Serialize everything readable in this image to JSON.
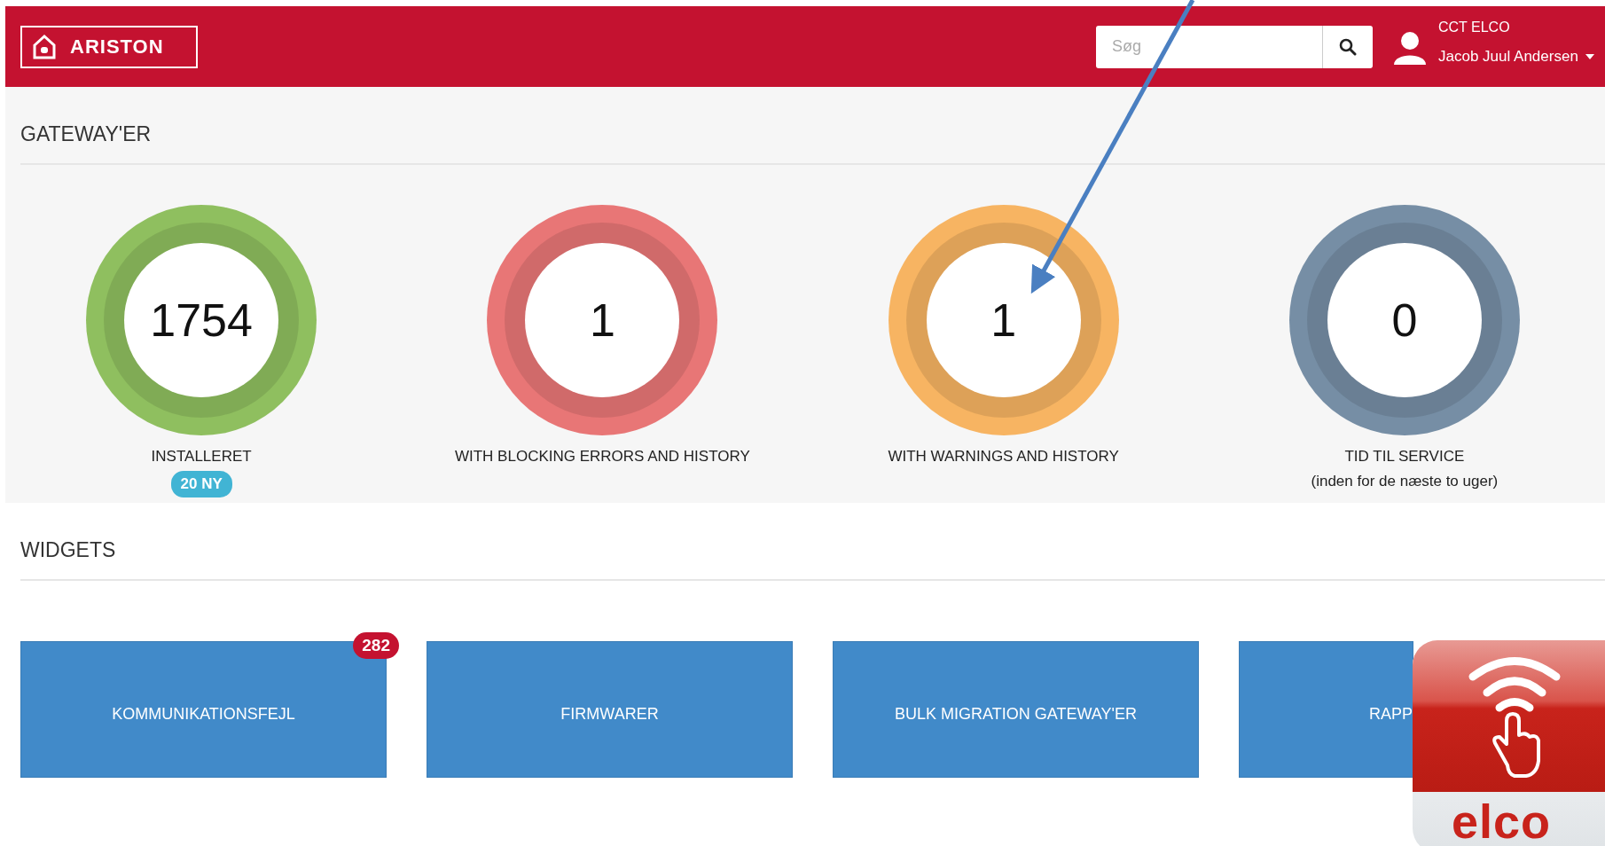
{
  "header": {
    "logo": "ARISTON",
    "search": {
      "placeholder": "Søg"
    },
    "user": {
      "company": "CCT ELCO",
      "name": "Jacob Juul Andersen"
    }
  },
  "gateways": {
    "title": "GATEWAY'ER",
    "gauges": [
      {
        "value": "1754",
        "label": "INSTALLERET",
        "badge": "20 NY",
        "color": "#8fbf5f"
      },
      {
        "value": "1",
        "label": "WITH BLOCKING ERRORS AND HISTORY",
        "color": "#e87676"
      },
      {
        "value": "1",
        "label": "WITH WARNINGS AND HISTORY",
        "color": "#f7b462"
      },
      {
        "value": "0",
        "label": "TID TIL SERVICE",
        "note": "(inden for de næste to uger)",
        "color": "#768ea5"
      }
    ]
  },
  "widgets": {
    "title": "WIDGETS",
    "tiles": [
      {
        "label": "KOMMUNIKATIONSFEJL",
        "badge": "282",
        "kind": "full"
      },
      {
        "label": "FIRMWARER",
        "kind": "full"
      },
      {
        "label": "BULK MIGRATION GATEWAY'ER",
        "kind": "full"
      },
      {
        "label": "RAPP",
        "kind": "cut"
      }
    ]
  },
  "app_icon": {
    "brand": "elco"
  }
}
